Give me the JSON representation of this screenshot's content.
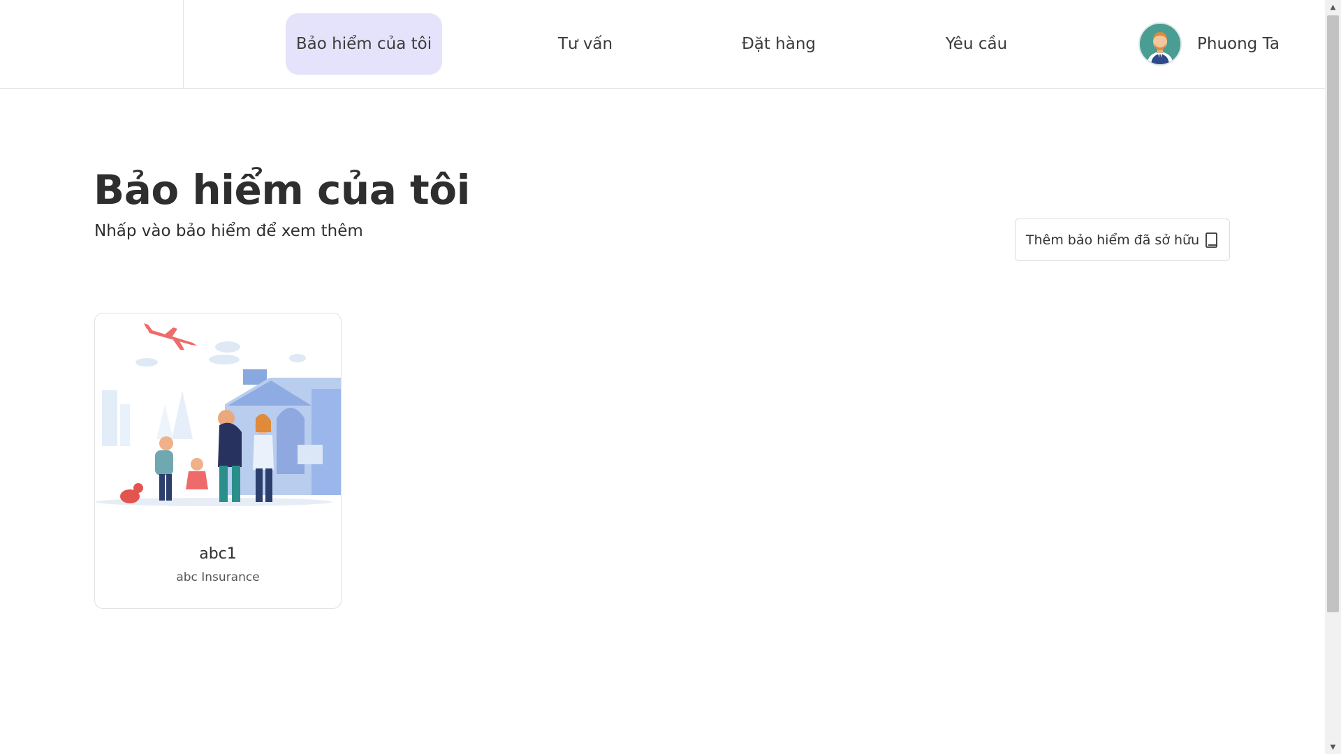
{
  "header": {
    "nav": [
      {
        "label": "Bảo hiểm của tôi",
        "active": true
      },
      {
        "label": "Tư vấn",
        "active": false
      },
      {
        "label": "Đặt hàng",
        "active": false
      },
      {
        "label": "Yêu cầu",
        "active": false
      }
    ],
    "user": {
      "name": "Phuong Ta",
      "avatar_icon": "user-avatar-icon"
    }
  },
  "main": {
    "title": "Bảo hiểm của tôi",
    "subtitle": "Nhấp vào bảo hiểm để xem thêm",
    "add_button_label": "Thêm bảo hiểm đã sở hữu",
    "add_button_icon": "document-icon",
    "cards": [
      {
        "name": "abc1",
        "provider": "abc Insurance",
        "illustration": "family-travel-illustration"
      }
    ]
  },
  "colors": {
    "active_nav_bg": "#e4e3fb",
    "text": "#2e2e2e",
    "border": "#e2e2e2"
  }
}
